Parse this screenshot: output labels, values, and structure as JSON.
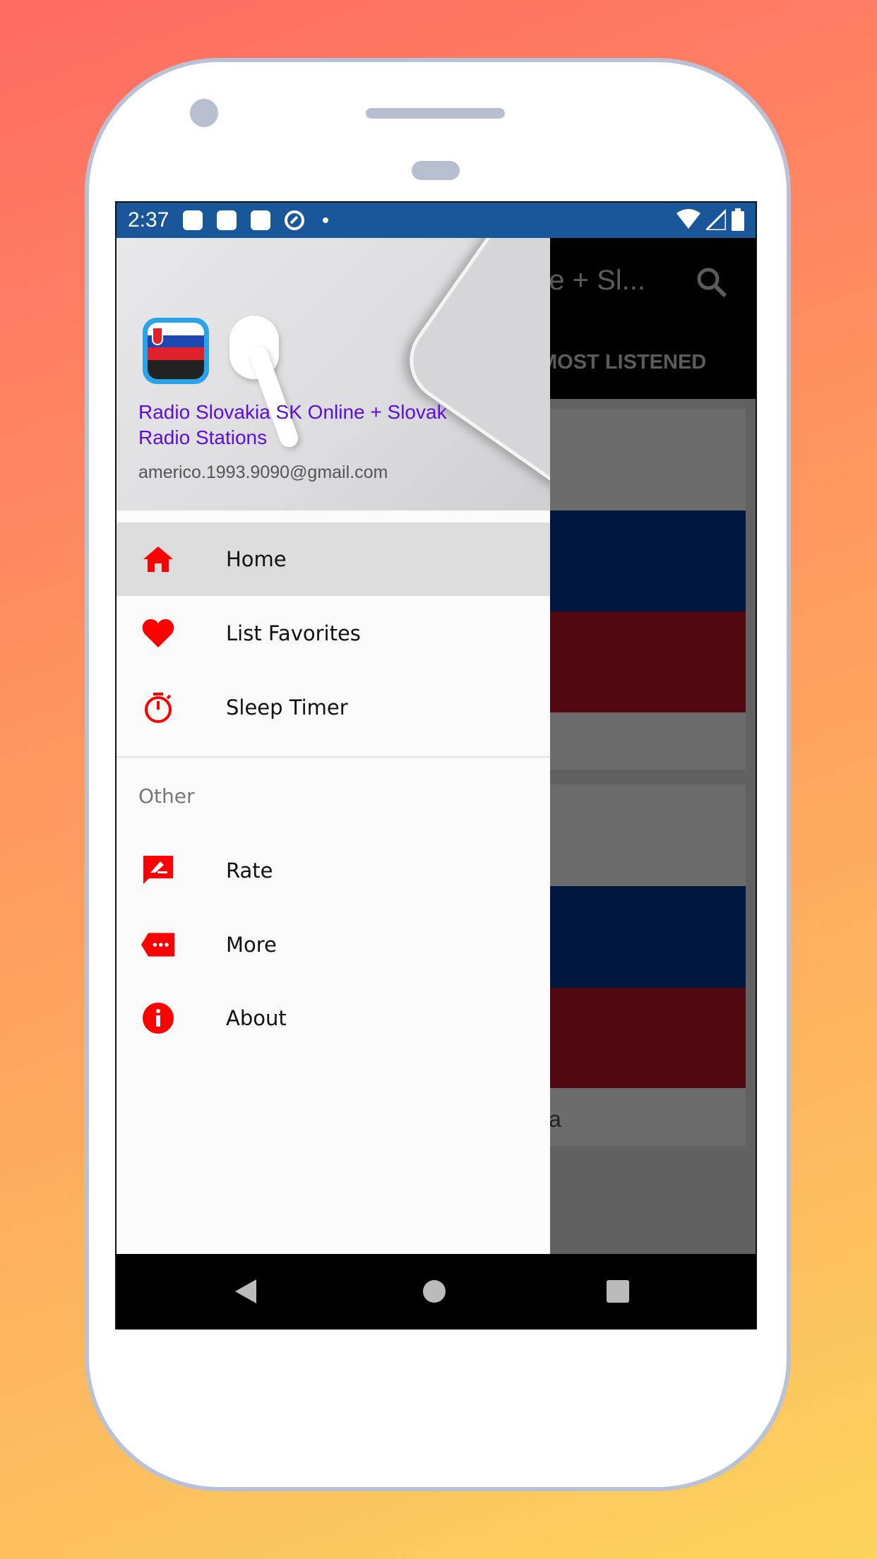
{
  "status_bar": {
    "time": "2:37"
  },
  "app_bar": {
    "title_fragment": "ne + Sl...",
    "tab_fragment": "MOST LISTENED"
  },
  "behind_content": {
    "card_text_fragment": "a"
  },
  "drawer": {
    "header": {
      "app_name": "Radio Slovakia SK Online + Slovak Radio Stations",
      "email": "americo.1993.9090@gmail.com"
    },
    "items": [
      {
        "label": "Home",
        "icon": "home-icon",
        "selected": true
      },
      {
        "label": "List Favorites",
        "icon": "heart-icon"
      },
      {
        "label": "Sleep Timer",
        "icon": "timer-icon"
      }
    ],
    "section_title": "Other",
    "other_items": [
      {
        "label": "Rate",
        "icon": "rate-icon"
      },
      {
        "label": "More",
        "icon": "more-icon"
      },
      {
        "label": "About",
        "icon": "info-icon"
      }
    ]
  },
  "colors": {
    "accent": "#ff0000",
    "status_bar": "#1a579a",
    "header_text": "#5b0ee0"
  }
}
